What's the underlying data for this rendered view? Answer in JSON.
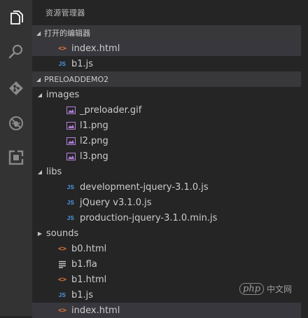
{
  "explorer": {
    "title": "资源管理器"
  },
  "open_editors": {
    "header": "打开的编辑器",
    "items": [
      {
        "label": "index.html",
        "type": "html"
      },
      {
        "label": "b1.js",
        "type": "js"
      }
    ]
  },
  "project": {
    "header": "PRELOADDEMO2",
    "tree": {
      "images": {
        "label": "images",
        "files": [
          "_preloader.gif",
          "l1.png",
          "l2.png",
          "l3.png"
        ]
      },
      "libs": {
        "label": "libs",
        "files": [
          "development-jquery-3.1.0.js",
          "jQuery v3.1.0.js",
          "production-jquery-3.1.0.min.js"
        ]
      },
      "sounds": {
        "label": "sounds"
      },
      "root_files": [
        "b0.html",
        "b1.fla",
        "b1.html",
        "b1.js",
        "index.html"
      ]
    }
  },
  "icons": {
    "html": "<>",
    "js": "JS"
  },
  "watermark": {
    "badge": "php",
    "text": "中文网"
  },
  "colors": {
    "activity_bar": "#333333",
    "sidebar": "#252526",
    "section_header": "#38383a",
    "selected_row": "#37373d",
    "html_icon": "#e37933",
    "js_icon": "#4d9ee8",
    "image_icon": "#b180d7"
  }
}
